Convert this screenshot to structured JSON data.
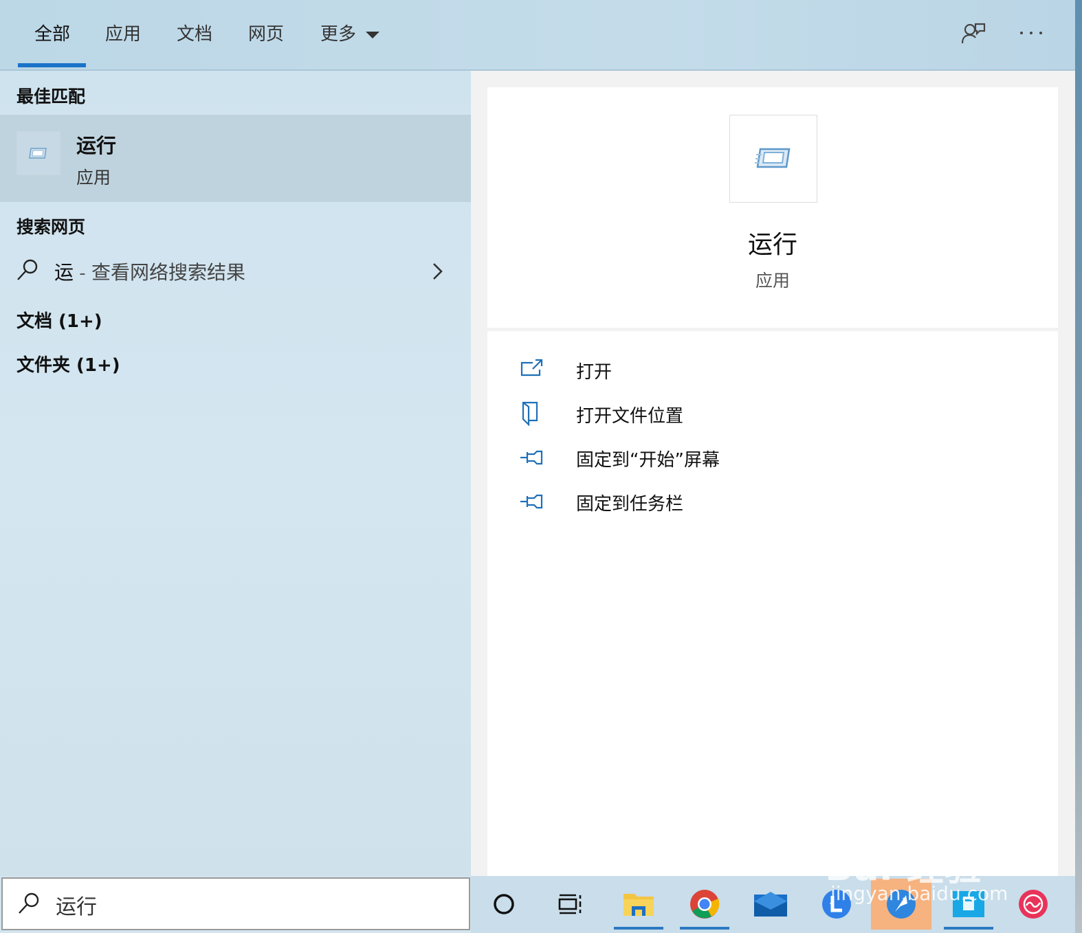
{
  "tabs": [
    {
      "label": "全部",
      "active": true
    },
    {
      "label": "应用"
    },
    {
      "label": "文档"
    },
    {
      "label": "网页"
    },
    {
      "label": "更多"
    }
  ],
  "top_icons": [
    "feedback-icon",
    "more-options-icon"
  ],
  "left": {
    "best_match_title": "最佳匹配",
    "best_match": {
      "name": "运行",
      "type": "应用",
      "icon": "run-app-icon"
    },
    "web_title": "搜索网页",
    "web_query": {
      "term": "运",
      "separator": " - ",
      "suffix": "查看网络搜索结果"
    },
    "groups": [
      {
        "label": "文档 (1+)"
      },
      {
        "label": "文件夹 (1+)"
      }
    ]
  },
  "detail": {
    "name": "运行",
    "type": "应用",
    "actions": [
      {
        "label": "打开",
        "icon": "open-icon"
      },
      {
        "label": "打开文件位置",
        "icon": "file-location-icon"
      },
      {
        "label": "固定到“开始”屏幕",
        "icon": "pin-icon"
      },
      {
        "label": "固定到任务栏",
        "icon": "pin-icon"
      }
    ]
  },
  "search": {
    "value": "运行"
  },
  "taskbar": [
    "cortana-icon",
    "task-view-icon",
    "file-explorer-icon",
    "chrome-icon",
    "mail-icon",
    "app-l-icon",
    "feather-app-icon",
    "baidu-app-icon",
    "red-app-icon"
  ],
  "watermark": {
    "brand": "Bai 经验",
    "url": "jingyan.baidu.com"
  },
  "colors": {
    "accent": "#1a73c8",
    "highlight_row": "#bfd3de",
    "taskbar_highlight": "#f6b27f"
  }
}
